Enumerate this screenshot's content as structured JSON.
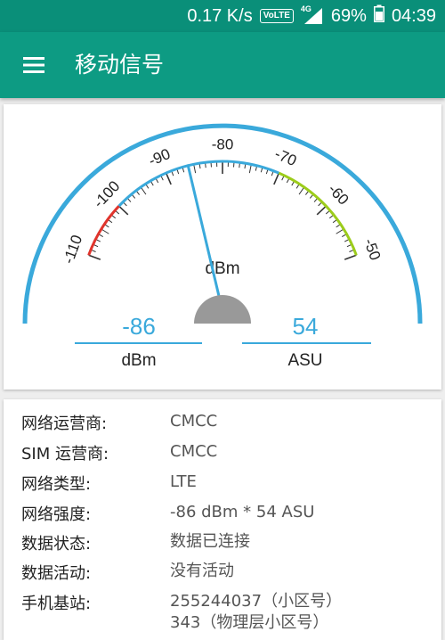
{
  "status_bar": {
    "speed": "0.17 K/s",
    "volte": "VoLTE",
    "network": "4G",
    "battery": "69%",
    "time": "04:39"
  },
  "app_bar": {
    "title": "移动信号",
    "menu_icon": "hamburger-menu-icon"
  },
  "gauge": {
    "unit_label": "dBm",
    "needle_value": -86,
    "min": -110,
    "max": -50,
    "ticks": [
      "-110",
      "-100",
      "-90",
      "-80",
      "-70",
      "-60",
      "-50"
    ],
    "dbm_value": "-86",
    "dbm_label": "dBm",
    "asu_value": "54",
    "asu_label": "ASU",
    "colors": {
      "arc": "#3aa9db",
      "low": "#e0342c",
      "high": "#9ccc1b",
      "mid": "#3aa9db",
      "value_text": "#3aa9db",
      "hub": "#999999"
    }
  },
  "info": [
    {
      "label": "网络运营商:",
      "value": "CMCC"
    },
    {
      "label": "SIM 运营商:",
      "value": "CMCC"
    },
    {
      "label": "网络类型:",
      "value": "LTE"
    },
    {
      "label": "网络强度:",
      "value": "-86 dBm * 54 ASU"
    },
    {
      "label": "数据状态:",
      "value": "数据已连接"
    },
    {
      "label": "数据活动:",
      "value": "没有活动"
    },
    {
      "label": "手机基站:",
      "value": "255244037（小区号）",
      "value2": "343（物理层小区号）"
    }
  ]
}
